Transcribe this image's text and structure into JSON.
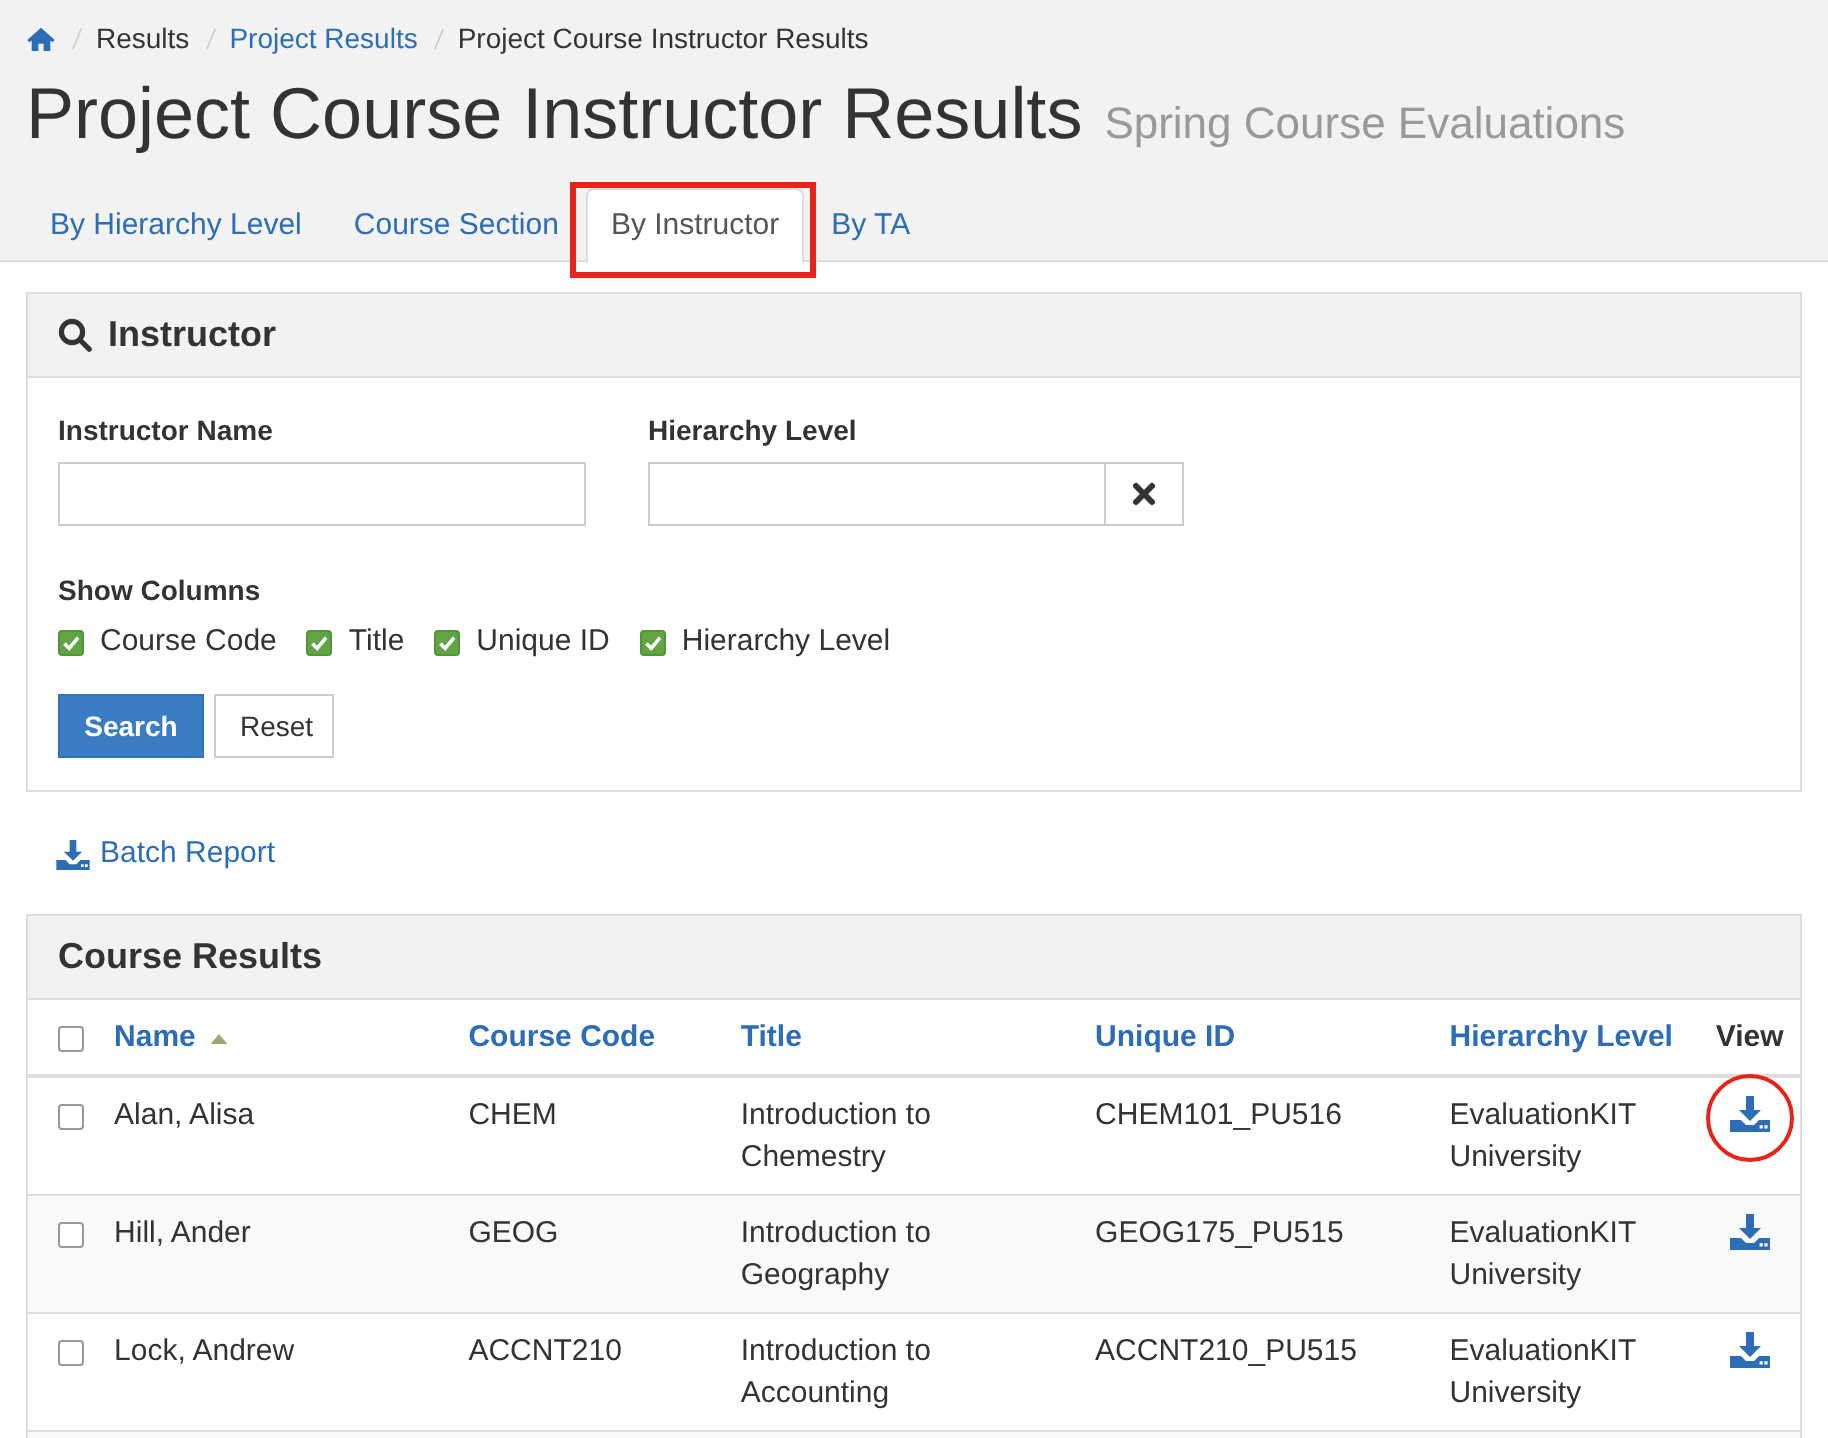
{
  "breadcrumb": [
    {
      "label": "Results",
      "kind": "text"
    },
    {
      "label": "Project Results",
      "kind": "link"
    },
    {
      "label": "Project Course Instructor Results",
      "kind": "text"
    }
  ],
  "page_header": {
    "title": "Project Course Instructor Results",
    "subtitle": "Spring Course Evaluations"
  },
  "tabs": [
    {
      "label": "By Hierarchy Level",
      "selected": false,
      "highlighted": false
    },
    {
      "label": "Course Section",
      "selected": false,
      "highlighted": false
    },
    {
      "label": "By Instructor",
      "selected": true,
      "highlighted": true
    },
    {
      "label": "By TA",
      "selected": false,
      "highlighted": false
    }
  ],
  "search_panel": {
    "title": "Instructor",
    "fields": [
      {
        "label": "Instructor Name",
        "kind": "text"
      },
      {
        "label": "Hierarchy Level",
        "kind": "clearable"
      }
    ],
    "show_columns": {
      "label": "Show Columns",
      "options": [
        {
          "label": "Course Code",
          "checked": true
        },
        {
          "label": "Title",
          "checked": true
        },
        {
          "label": "Unique ID",
          "checked": true
        },
        {
          "label": "Hierarchy Level",
          "checked": true
        }
      ]
    },
    "buttons": [
      {
        "label": "Search",
        "kind": "primary"
      },
      {
        "label": "Reset",
        "kind": "default"
      }
    ]
  },
  "batch_report": {
    "label": "Batch Report"
  },
  "results": {
    "title": "Course Results",
    "select_all": {
      "checked": false
    },
    "columns": [
      {
        "label": "Name",
        "sortable": true,
        "sorted": true
      },
      {
        "label": "Course Code",
        "sortable": true,
        "sorted": false
      },
      {
        "label": "Title",
        "sortable": true,
        "sorted": false
      },
      {
        "label": "Unique ID",
        "sortable": true,
        "sorted": false
      },
      {
        "label": "Hierarchy Level",
        "sortable": true,
        "sorted": false
      },
      {
        "label": "View",
        "sortable": false,
        "sorted": false
      }
    ],
    "rows": [
      {
        "selected": false,
        "highlighted": true,
        "cells": [
          "Alan, Alisa",
          "CHEM",
          "Introduction to Chemestry",
          "CHEM101_PU516",
          "EvaluationKIT University"
        ]
      },
      {
        "selected": false,
        "highlighted": false,
        "cells": [
          "Hill, Ander",
          "GEOG",
          "Introduction to Geography",
          "GEOG175_PU515",
          "EvaluationKIT University"
        ]
      },
      {
        "selected": false,
        "highlighted": false,
        "cells": [
          "Lock, Andrew",
          "ACCNT210",
          "Introduction to Accounting",
          "ACCNT210_PU515",
          "EvaluationKIT University"
        ]
      }
    ]
  }
}
